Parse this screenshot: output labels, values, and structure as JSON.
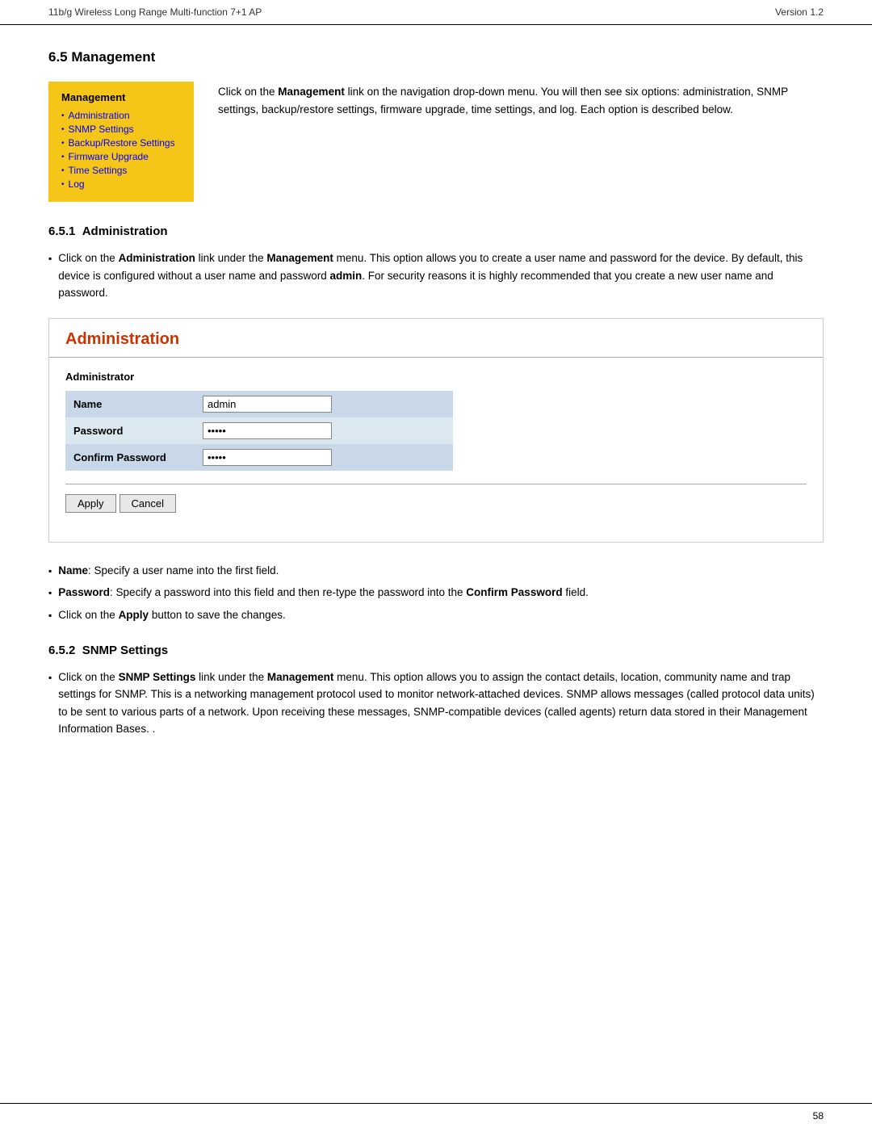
{
  "header": {
    "left": "11b/g Wireless Long Range Multi-function 7+1 AP",
    "right": "Version 1.2"
  },
  "section_65": {
    "number": "6.5",
    "title": "Management",
    "menu": {
      "title": "Management",
      "items": [
        "Administration",
        "SNMP Settings",
        "Backup/Restore Settings",
        "Firmware Upgrade",
        "Time Settings",
        "Log"
      ]
    },
    "description": "Click on the Management link on the navigation drop-down menu. You will then see six options: administration, SNMP settings, backup/restore settings, firmware upgrade, time settings, and log. Each option is described below."
  },
  "section_651": {
    "number": "6.5.1",
    "title": "Administration",
    "intro_bullet": "Click on the Administration link under the Management menu. This option allows you to create a user name and password for the device. By default, this device is configured without a user name and password admin. For security reasons it is highly recommended that you create a new user name and password.",
    "panel": {
      "title": "Administration",
      "section_label": "Administrator",
      "fields": [
        {
          "label": "Name",
          "type": "text",
          "value": "admin"
        },
        {
          "label": "Password",
          "type": "password",
          "value": "•••••"
        },
        {
          "label": "Confirm Password",
          "type": "password",
          "value": "•••••"
        }
      ],
      "buttons": [
        "Apply",
        "Cancel"
      ]
    },
    "notes": [
      {
        "bold": "Name",
        "text": ": Specify a user name into the first field."
      },
      {
        "bold": "Password",
        "text": ": Specify a password into this field and then re-type the password into the Confirm Password field."
      },
      {
        "text": "Click on the Apply button to save the changes."
      }
    ]
  },
  "section_652": {
    "number": "6.5.2",
    "title": "SNMP Settings",
    "bullet": "Click on the SNMP Settings link under the Management menu. This option allows you to assign the contact details, location, community name and trap settings for SNMP. This is a networking management protocol used to monitor network-attached devices. SNMP allows messages (called protocol data units) to be sent to various parts of a network. Upon receiving these messages, SNMP-compatible devices (called agents) return data stored in their Management Information Bases. ."
  },
  "footer": {
    "page_number": "58"
  }
}
